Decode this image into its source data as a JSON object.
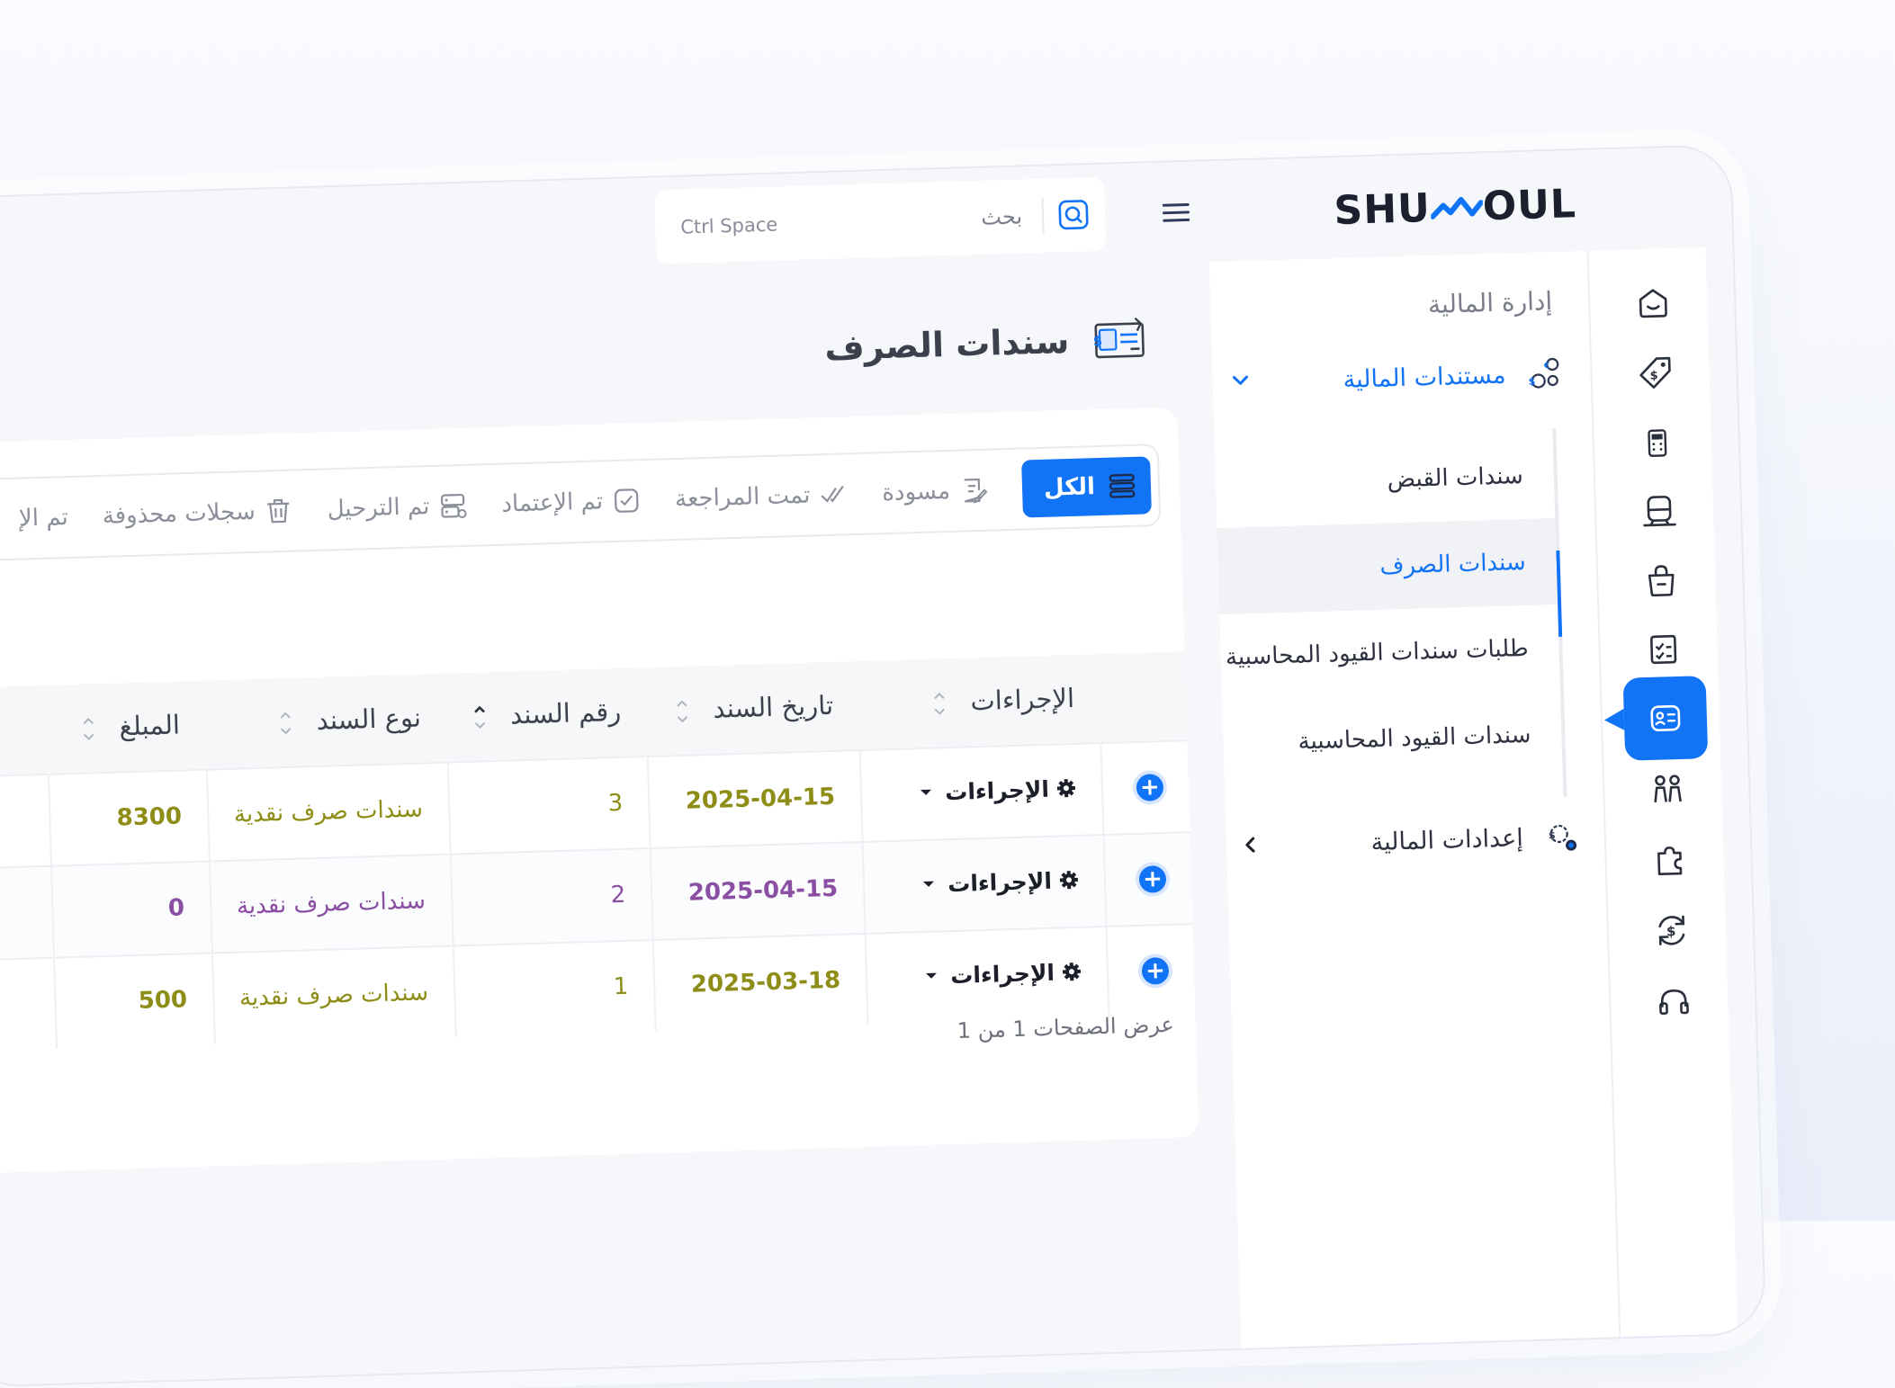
{
  "brand": {
    "logo_left": "SHU",
    "logo_right": "OUL"
  },
  "search": {
    "label": "بحث",
    "shortcut": "Ctrl Space"
  },
  "sidebar": {
    "section_title": "إدارة المالية",
    "group": {
      "label": "مستندات المالية",
      "icon": "coins-icon"
    },
    "children": [
      {
        "label": "سندات القبض"
      },
      {
        "label": "سندات الصرف",
        "active": true
      },
      {
        "label": "طلبات سندات القيود المحاسبية"
      },
      {
        "label": "سندات القيود المحاسبية"
      }
    ],
    "group2": {
      "label": "إعدادات المالية",
      "icon": "settings-coins-icon"
    }
  },
  "rail": [
    "home-icon",
    "tag-icon",
    "calculator-icon",
    "train-icon",
    "bag-icon",
    "checklist-icon",
    "id-card-icon",
    "people-icon",
    "puzzle-icon",
    "dollar-refresh-icon",
    "headset-icon"
  ],
  "page": {
    "title": "سندات الصرف"
  },
  "tabs": [
    {
      "label": "الكل",
      "icon": "list-icon",
      "active": true
    },
    {
      "label": "مسودة",
      "icon": "draft-icon"
    },
    {
      "label": "تمت المراجعة",
      "icon": "double-check-icon"
    },
    {
      "label": "تم الإعتماد",
      "icon": "check-box-icon"
    },
    {
      "label": "تم الترحيل",
      "icon": "server-icon"
    },
    {
      "label": "سجلات محذوفة",
      "icon": "trash-icon"
    },
    {
      "label": "تم الإ"
    }
  ],
  "table": {
    "columns": [
      "الإجراءات",
      "تاريخ السند",
      "رقم السند",
      "نوع السند",
      "المبلغ"
    ],
    "action_label": "الإجراءات",
    "rows": [
      {
        "date": "2025-04-15",
        "number": "3",
        "type": "سندات صرف نقدية",
        "amount": "8300",
        "tone": "olive"
      },
      {
        "date": "2025-04-15",
        "number": "2",
        "type": "سندات صرف نقدية",
        "amount": "0",
        "tone": "purple"
      },
      {
        "date": "2025-03-18",
        "number": "1",
        "type": "سندات صرف نقدية",
        "amount": "500",
        "tone": "olive"
      }
    ]
  },
  "pagination": {
    "text": "عرض الصفحات 1 من 1"
  },
  "colors": {
    "accent": "#1173f5",
    "olive": "#8e8d17",
    "purple": "#8a4fa3"
  }
}
